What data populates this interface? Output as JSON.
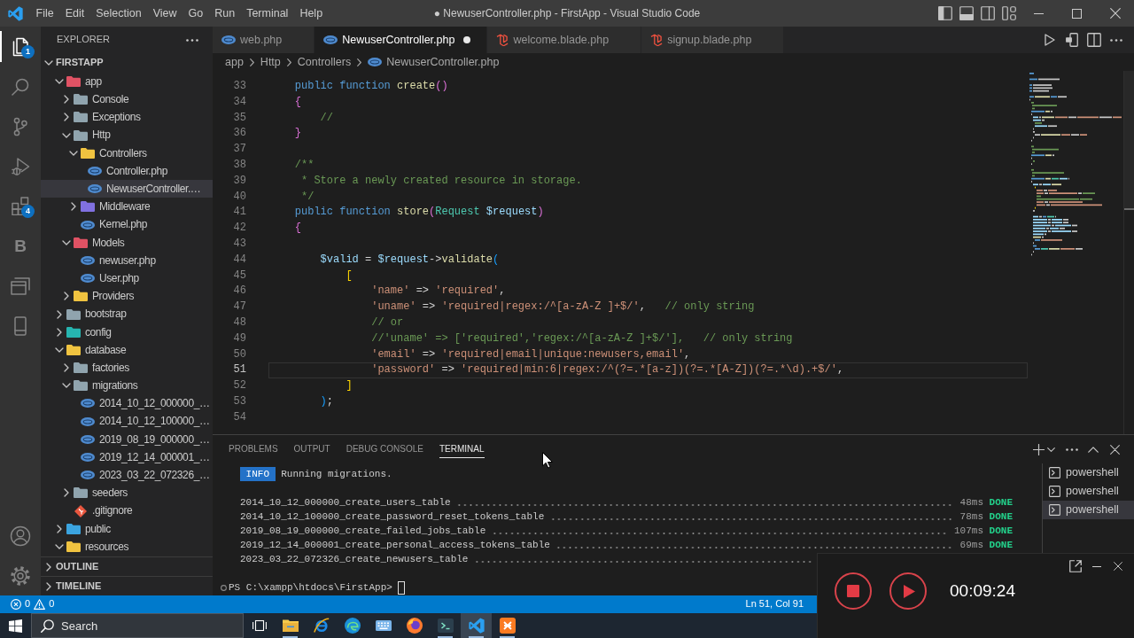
{
  "title_bar": {
    "menu": [
      "File",
      "Edit",
      "Selection",
      "View",
      "Go",
      "Run",
      "Terminal",
      "Help"
    ],
    "title": "● NewuserController.php - FirstApp - Visual Studio Code"
  },
  "activity_bar": {
    "items": [
      {
        "kind": "files",
        "selected": true,
        "badge": "1"
      },
      {
        "kind": "search",
        "selected": false
      },
      {
        "kind": "source-control",
        "selected": false
      },
      {
        "kind": "run-debug",
        "selected": false
      },
      {
        "kind": "extensions",
        "selected": false,
        "badge": "4"
      },
      {
        "kind": "letter",
        "label": "B",
        "selected": false
      },
      {
        "kind": "windows",
        "selected": false
      },
      {
        "kind": "tablet",
        "selected": false
      }
    ],
    "bottom": [
      {
        "kind": "account"
      },
      {
        "kind": "settings"
      }
    ]
  },
  "sidebar": {
    "title": "EXPLORER",
    "root": {
      "label": "FIRSTAPP",
      "expanded": true
    },
    "tree": [
      {
        "label": "app",
        "kind": "folder",
        "color": "#e05264",
        "expanded": true,
        "selected": false,
        "children": [
          {
            "label": "Console",
            "kind": "folder",
            "color": "#90a4ae",
            "expanded": false,
            "selected": false
          },
          {
            "label": "Exceptions",
            "kind": "folder",
            "color": "#90a4ae",
            "expanded": false,
            "selected": false
          },
          {
            "label": "Http",
            "kind": "folder",
            "color": "#90a4ae",
            "expanded": true,
            "selected": false,
            "children": [
              {
                "label": "Controllers",
                "kind": "folder",
                "color": "#f0c340",
                "expanded": true,
                "selected": false,
                "children": [
                  {
                    "label": "Controller.php",
                    "kind": "php",
                    "selected": false
                  },
                  {
                    "label": "NewuserController.…",
                    "kind": "php",
                    "selected": true
                  }
                ]
              },
              {
                "label": "Middleware",
                "kind": "folder",
                "color": "#8070e0",
                "expanded": false,
                "selected": false
              },
              {
                "label": "Kernel.php",
                "kind": "php",
                "selected": false
              }
            ]
          },
          {
            "label": "Models",
            "kind": "folder",
            "color": "#e05264",
            "expanded": true,
            "selected": false,
            "children": [
              {
                "label": "newuser.php",
                "kind": "php",
                "selected": false
              },
              {
                "label": "User.php",
                "kind": "php",
                "selected": false
              }
            ]
          },
          {
            "label": "Providers",
            "kind": "folder",
            "color": "#f0c340",
            "expanded": false,
            "selected": false
          }
        ]
      },
      {
        "label": "bootstrap",
        "kind": "folder",
        "color": "#90a4ae",
        "expanded": false,
        "selected": false
      },
      {
        "label": "config",
        "kind": "folder",
        "color": "#26b5b0",
        "expanded": false,
        "selected": false
      },
      {
        "label": "database",
        "kind": "folder",
        "color": "#f0c340",
        "expanded": true,
        "selected": false,
        "children": [
          {
            "label": "factories",
            "kind": "folder",
            "color": "#90a4ae",
            "expanded": false,
            "selected": false
          },
          {
            "label": "migrations",
            "kind": "folder",
            "color": "#90a4ae",
            "expanded": true,
            "selected": false,
            "children": [
              {
                "label": "2014_10_12_000000_…",
                "kind": "php",
                "selected": false
              },
              {
                "label": "2014_10_12_100000_…",
                "kind": "php",
                "selected": false
              },
              {
                "label": "2019_08_19_000000_…",
                "kind": "php",
                "selected": false
              },
              {
                "label": "2019_12_14_000001_…",
                "kind": "php",
                "selected": false
              },
              {
                "label": "2023_03_22_072326_…",
                "kind": "php",
                "selected": false
              }
            ]
          },
          {
            "label": "seeders",
            "kind": "folder",
            "color": "#90a4ae",
            "expanded": false,
            "selected": false
          },
          {
            "label": ".gitignore",
            "kind": "git",
            "selected": false
          }
        ]
      },
      {
        "label": "public",
        "kind": "folder",
        "color": "#3ba4e0",
        "expanded": false,
        "selected": false
      },
      {
        "label": "resources",
        "kind": "folder",
        "color": "#f0c340",
        "expanded": true,
        "selected": false
      }
    ],
    "sections": [
      {
        "label": "OUTLINE",
        "expanded": false
      },
      {
        "label": "TIMELINE",
        "expanded": false
      }
    ]
  },
  "editor": {
    "tabs": [
      {
        "label": "web.php",
        "kind": "php",
        "selected": false,
        "modified": false
      },
      {
        "label": "NewuserController.php",
        "kind": "php",
        "selected": true,
        "modified": true
      },
      {
        "label": "welcome.blade.php",
        "kind": "blade",
        "selected": false,
        "modified": false
      },
      {
        "label": "signup.blade.php",
        "kind": "blade",
        "selected": false,
        "modified": false
      }
    ],
    "breadcrumbs": [
      {
        "label": "app",
        "kind": "folder"
      },
      {
        "label": "Http",
        "kind": "folder"
      },
      {
        "label": "Controllers",
        "kind": "folder"
      },
      {
        "label": "NewuserController.php",
        "kind": "php"
      }
    ],
    "lines": [
      {
        "number": "33",
        "current": false,
        "tokens": [
          {
            "kind": "keyword",
            "text": "    public function"
          },
          {
            "kind": "function",
            "text": " create"
          },
          {
            "kind": "bracket2",
            "text": "()"
          }
        ]
      },
      {
        "number": "34",
        "current": false,
        "tokens": [
          {
            "kind": "bracket2",
            "text": "    {"
          }
        ]
      },
      {
        "number": "35",
        "current": false,
        "tokens": [
          {
            "kind": "comment",
            "text": "        //"
          }
        ]
      },
      {
        "number": "36",
        "current": false,
        "tokens": [
          {
            "kind": "bracket2",
            "text": "    }"
          }
        ]
      },
      {
        "number": "37",
        "current": false
      },
      {
        "number": "38",
        "current": false,
        "tokens": [
          {
            "kind": "comment",
            "text": "    /**"
          }
        ]
      },
      {
        "number": "39",
        "current": false,
        "tokens": [
          {
            "kind": "comment",
            "text": "     * Store a newly created resource in storage."
          }
        ]
      },
      {
        "number": "40",
        "current": false,
        "tokens": [
          {
            "kind": "comment",
            "text": "     */"
          }
        ]
      },
      {
        "number": "41",
        "current": false,
        "tokens": [
          {
            "kind": "keyword",
            "text": "    public function"
          },
          {
            "kind": "function",
            "text": " store"
          },
          {
            "kind": "bracket2",
            "text": "("
          },
          {
            "kind": "class",
            "text": "Request"
          },
          {
            "kind": "variable",
            "text": " $request"
          },
          {
            "kind": "bracket2",
            "text": ")"
          }
        ]
      },
      {
        "number": "42",
        "current": false,
        "tokens": [
          {
            "kind": "bracket2",
            "text": "    {"
          }
        ]
      },
      {
        "number": "43",
        "current": false
      },
      {
        "number": "44",
        "current": false,
        "tokens": [
          {
            "kind": "variable",
            "text": "        $valid"
          },
          {
            "kind": "plain",
            "text": " = "
          },
          {
            "kind": "variable",
            "text": "$request"
          },
          {
            "kind": "plain",
            "text": "->"
          },
          {
            "kind": "function",
            "text": "validate"
          },
          {
            "kind": "bracket3",
            "text": "("
          }
        ]
      },
      {
        "number": "45",
        "current": false,
        "tokens": [
          {
            "kind": "bracket1",
            "text": "            ["
          }
        ]
      },
      {
        "number": "46",
        "current": false,
        "tokens": [
          {
            "kind": "string",
            "text": "                'name'"
          },
          {
            "kind": "plain",
            "text": " => "
          },
          {
            "kind": "string",
            "text": "'required'"
          },
          {
            "kind": "plain",
            "text": ","
          }
        ]
      },
      {
        "number": "47",
        "current": false,
        "tokens": [
          {
            "kind": "string",
            "text": "                'uname'"
          },
          {
            "kind": "plain",
            "text": " => "
          },
          {
            "kind": "string",
            "text": "'required|regex:/^[a-zA-Z ]+$/'"
          },
          {
            "kind": "plain",
            "text": ",   "
          },
          {
            "kind": "comment",
            "text": "// only string"
          }
        ]
      },
      {
        "number": "48",
        "current": false,
        "tokens": [
          {
            "kind": "comment",
            "text": "                // or"
          }
        ]
      },
      {
        "number": "49",
        "current": false,
        "tokens": [
          {
            "kind": "comment",
            "text": "                //'uname' => ['required','regex:/^[a-zA-Z ]+$/'],   // only string"
          }
        ]
      },
      {
        "number": "50",
        "current": false,
        "tokens": [
          {
            "kind": "string",
            "text": "                'email'"
          },
          {
            "kind": "plain",
            "text": " => "
          },
          {
            "kind": "string",
            "text": "'required|email|unique:newusers,email'"
          },
          {
            "kind": "plain",
            "text": ","
          }
        ]
      },
      {
        "number": "51",
        "current": true,
        "tokens": [
          {
            "kind": "string",
            "text": "                'password'"
          },
          {
            "kind": "plain",
            "text": " => "
          },
          {
            "kind": "string",
            "text": "'required|min:6|regex:/^(?=.*[a-z])(?=.*[A-Z])(?=.*\\d).+$/'"
          },
          {
            "kind": "plain",
            "text": ","
          }
        ]
      },
      {
        "number": "52",
        "current": false,
        "tokens": [
          {
            "kind": "bracket1",
            "text": "            ]"
          }
        ]
      },
      {
        "number": "53",
        "current": false,
        "tokens": [
          {
            "kind": "bracket3",
            "text": "        )"
          },
          {
            "kind": "plain",
            "text": ";"
          }
        ]
      },
      {
        "number": "54",
        "current": false
      }
    ]
  },
  "panel": {
    "tabs": [
      {
        "label": "PROBLEMS",
        "selected": false
      },
      {
        "label": "OUTPUT",
        "selected": false
      },
      {
        "label": "DEBUG CONSOLE",
        "selected": false
      },
      {
        "label": "TERMINAL",
        "selected": true
      }
    ],
    "terminal": {
      "info_label": "INFO",
      "info_text": "Running migrations.",
      "migrations": [
        {
          "name": "2014_10_12_000000_create_users_table",
          "time": "48ms",
          "status": "DONE"
        },
        {
          "name": "2014_10_12_100000_create_password_reset_tokens_table",
          "time": "78ms",
          "status": "DONE"
        },
        {
          "name": "2019_08_19_000000_create_failed_jobs_table",
          "time": "107ms",
          "status": "DONE"
        },
        {
          "name": "2019_12_14_000001_create_personal_access_tokens_table",
          "time": "69ms",
          "status": "DONE"
        },
        {
          "name": "2023_03_22_072326_create_newusers_table"
        }
      ],
      "prompt": "PS C:\\xampp\\htdocs\\FirstApp>"
    },
    "terminals": [
      {
        "label": "powershell",
        "selected": false
      },
      {
        "label": "powershell",
        "selected": false
      },
      {
        "label": "powershell",
        "selected": true
      }
    ]
  },
  "status_bar": {
    "errors": "0",
    "warnings": "0",
    "cursor_position": "Ln 51, Col 91"
  },
  "taskbar": {
    "search": {
      "placeholder": "Search"
    },
    "apps": [
      {
        "kind": "task-view",
        "running": false,
        "selected": false
      },
      {
        "kind": "file-explorer",
        "running": true,
        "selected": false
      },
      {
        "kind": "ring-browser",
        "running": false,
        "selected": false
      },
      {
        "kind": "swirl-browser",
        "running": false,
        "selected": false
      },
      {
        "kind": "keyboard",
        "running": false,
        "selected": false
      },
      {
        "kind": "fox-browser",
        "running": false,
        "selected": false
      },
      {
        "kind": "terminal",
        "running": true,
        "selected": false
      },
      {
        "kind": "editor",
        "running": true,
        "selected": true
      },
      {
        "kind": "x-server",
        "running": true,
        "selected": false
      }
    ]
  },
  "recorder": {
    "time": "00:09:24"
  }
}
